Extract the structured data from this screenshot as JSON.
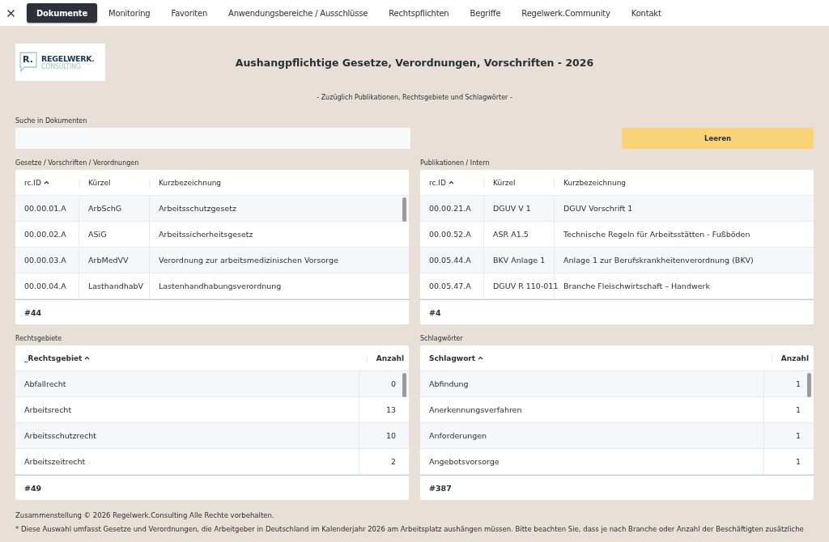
{
  "nav": {
    "tabs": [
      {
        "label": "Dokumente",
        "selected": true
      },
      {
        "label": "Monitoring",
        "selected": false
      },
      {
        "label": "Favoriten",
        "selected": false
      },
      {
        "label": "Anwendungsbereiche / Ausschlüsse",
        "selected": false
      },
      {
        "label": "Rechtspflichten",
        "selected": false
      },
      {
        "label": "Begriffe",
        "selected": false
      },
      {
        "label": "Regelwerk.Community",
        "selected": false
      },
      {
        "label": "Kontakt",
        "selected": false
      }
    ]
  },
  "header": {
    "logo": {
      "mark": "R.",
      "name": "REGELWERK",
      "dot": ".",
      "sub": "CONSULTING"
    },
    "title": "Aushangpflichtige Gesetze, Verordnungen, Vorschriften - 2026",
    "subtitle": "- Zuzüglich Publikationen, Rechtsgebiete und Schlagwörter -"
  },
  "search": {
    "label": "Suche in Dokumenten",
    "clear_button": "Leeren"
  },
  "tables": [
    {
      "kind": "documents",
      "label": "Gesetze / Vorschriften / Verordnungen",
      "scrollbar": true,
      "columns": [
        {
          "title": "rc.ID",
          "sorted": true
        },
        {
          "title": "Kürzel",
          "sorted": false
        },
        {
          "title": "Kurzbezeichnung",
          "sorted": false
        }
      ],
      "rows": [
        [
          "00.00.01.A",
          "ArbSchG",
          "Arbeitsschutzgesetz"
        ],
        [
          "00.00.02.A",
          "ASiG",
          "Arbeitssicherheitsgesetz"
        ],
        [
          "00.00.03.A",
          "ArbMedVV",
          "Verordnung zur arbeitsmedizinischen Vorsorge"
        ],
        [
          "00.00.04.A",
          "LasthandhabV",
          "Lastenhandhabungsverordnung"
        ]
      ],
      "count": "#44"
    },
    {
      "kind": "documents",
      "label": "Publikationen / Intern",
      "scrollbar": false,
      "columns": [
        {
          "title": "rc.ID",
          "sorted": true
        },
        {
          "title": "Kürzel",
          "sorted": false
        },
        {
          "title": "Kurzbezeichnung",
          "sorted": false
        }
      ],
      "rows": [
        [
          "00.00.21.A",
          "DGUV V 1",
          "DGUV Vorschrift 1"
        ],
        [
          "00.00.52.A",
          "ASR A1.5",
          "Technische Regeln für Arbeitsstätten - Fußböden"
        ],
        [
          "00.05.44.A",
          "BKV Anlage 1",
          "Anlage 1 zur Berufskrankheitenverordnung (BKV)"
        ],
        [
          "00.05.47.A",
          "DGUV R 110-011",
          "Branche Fleischwirtschaft – Handwerk"
        ]
      ],
      "count": "#4"
    },
    {
      "kind": "counts",
      "label": "Rechtsgebiete",
      "scrollbar": true,
      "columns": [
        {
          "title": "_Rechtsgebiet",
          "sorted": true
        },
        {
          "title": "Anzahl",
          "sorted": false
        }
      ],
      "rows": [
        [
          "Abfallrecht",
          "0"
        ],
        [
          "Arbeitsrecht",
          "13"
        ],
        [
          "Arbeitsschutzrecht",
          "10"
        ],
        [
          "Arbeitszeitrecht",
          "2"
        ]
      ],
      "count": "#49"
    },
    {
      "kind": "counts",
      "label": "Schlagwörter",
      "scrollbar": true,
      "columns": [
        {
          "title": "Schlagwort",
          "sorted": true
        },
        {
          "title": "Anzahl",
          "sorted": false
        }
      ],
      "rows": [
        [
          "Abfindung",
          "1"
        ],
        [
          "Anerkennungsverfahren",
          "1"
        ],
        [
          "Anforderungen",
          "1"
        ],
        [
          "Angebotsvorsorge",
          "1"
        ]
      ],
      "count": "#387"
    }
  ],
  "footer": {
    "copyright": "Zusammenstellung © 2026 Regelwerk.Consulting  Alle Rechte vorbehalten.",
    "note": "* Diese Auswahl umfasst Gesetze und Verordnungen, die Arbeitgeber in Deutschland im Kalenderjahr 2026 am Arbeitsplatz aushängen müssen. Bitte beachten Sie, dass je nach Branche oder Anzahl der Beschäftigten zusätzliche"
  }
}
